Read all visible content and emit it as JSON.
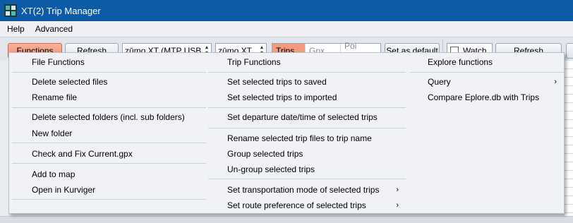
{
  "window": {
    "title": "XT(2) Trip Manager"
  },
  "menubar": {
    "items": [
      "Help",
      "Advanced"
    ]
  },
  "toolbar": {
    "functions_label": "Functions",
    "refresh_label": "Refresh",
    "device_value": "zūmo XT (MTP USB Dev",
    "model_value": "zūmo XT",
    "tabs": [
      "Trips",
      "Gpx",
      "Poi (Gpi)"
    ],
    "set_default_label": "Set as default",
    "watch_label": "Watch",
    "refresh2_label": "Refresh"
  },
  "colors": {
    "titlebar": "#0d5aa7",
    "functions_button": "#f08d6c",
    "active_tab": "#f49b7e"
  },
  "functions_menu": {
    "file": {
      "header": "File Functions",
      "items": [
        "Delete selected files",
        "Rename file",
        "Delete selected folders (incl. sub folders)",
        "New folder",
        "Check and Fix Current.gpx",
        "Add to map",
        "Open in Kurviger"
      ]
    },
    "trip": {
      "header": "Trip Functions",
      "items": [
        "Set selected trips to saved",
        "Set selected trips to imported",
        "Set departure date/time of selected trips",
        "Rename selected trip files to trip name",
        "Group selected trips",
        "Un-group selected trips",
        "Set transportation mode of selected trips",
        "Set route preference of selected trips"
      ]
    },
    "explore": {
      "header": "Explore functions",
      "items": [
        "Query",
        "Compare Eplore.db with Trips"
      ]
    }
  }
}
